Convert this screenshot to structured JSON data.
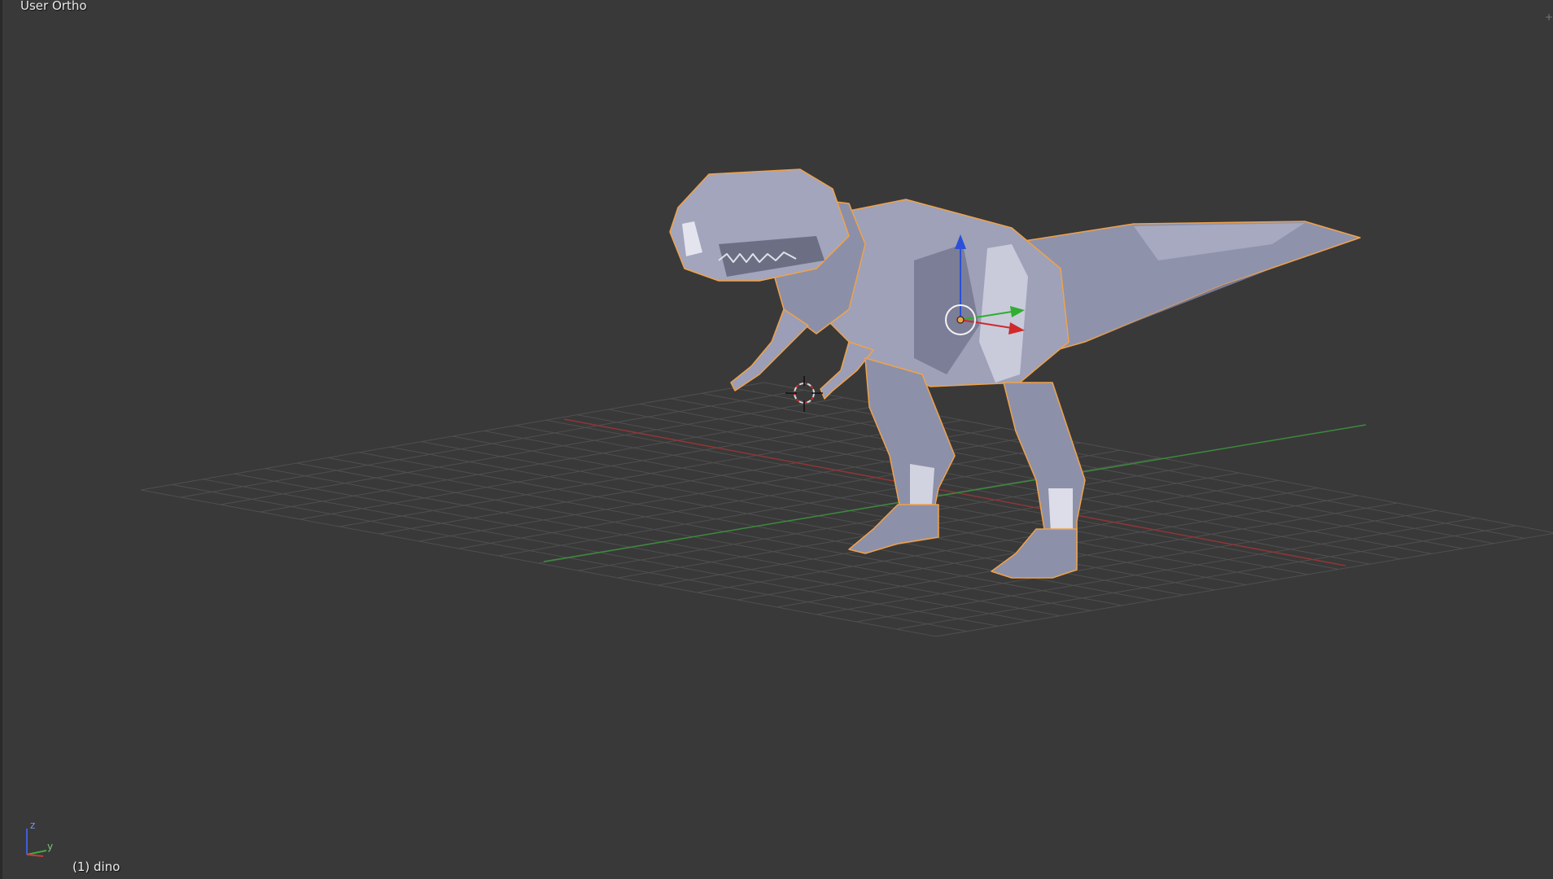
{
  "viewport": {
    "view_label": "User Ortho",
    "object_info": "(1) dino",
    "corner_widget_glyph": "+"
  },
  "axis_gizmo": {
    "z_label": "z",
    "y_label": "y"
  },
  "colors": {
    "background": "#393939",
    "grid": "#4e4e4e",
    "x_axis": "#a23a3a",
    "y_axis": "#3f8f3f",
    "z_axis": "#2b4fd6",
    "mesh": "#9da0b8",
    "selection_outline": "#f0a24a"
  },
  "icons": {
    "cursor": "3d-cursor-icon",
    "manipulator": "transform-manipulator-icon",
    "axis_gizmo": "axis-gizmo-icon"
  }
}
